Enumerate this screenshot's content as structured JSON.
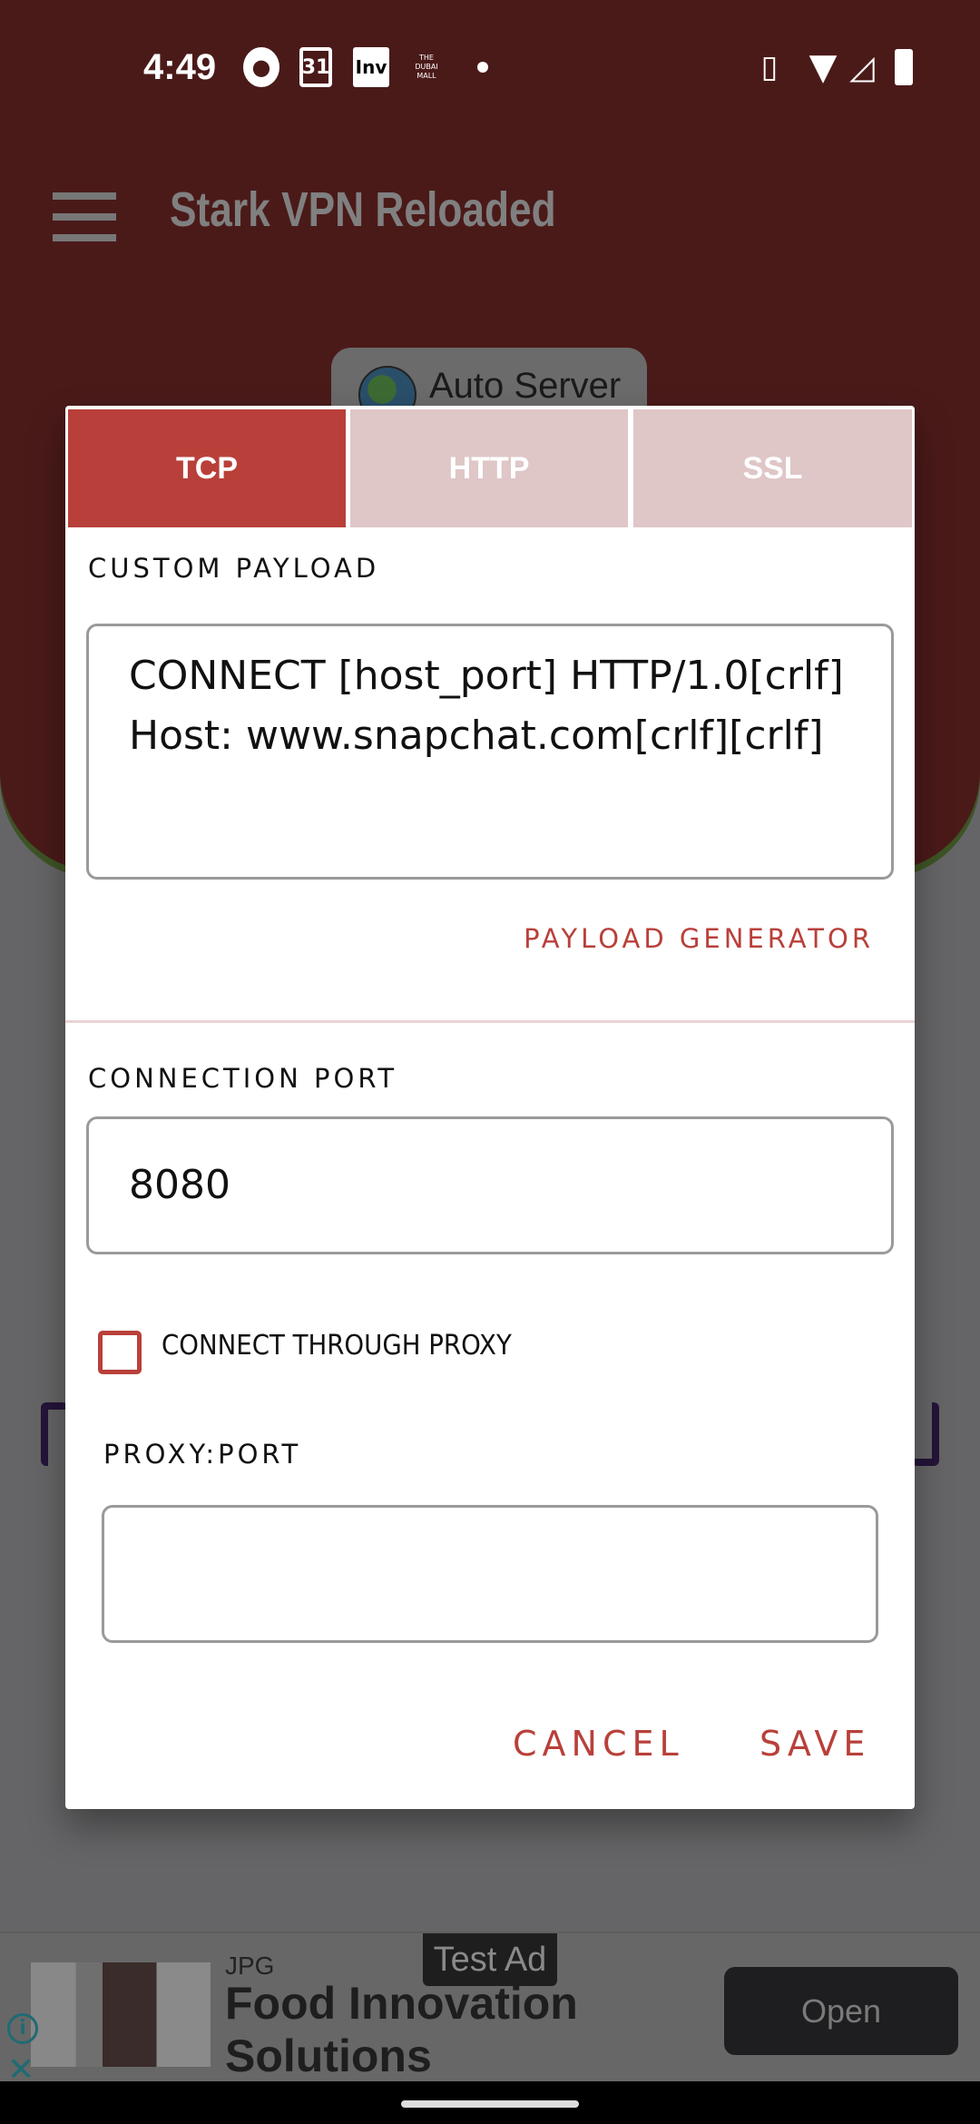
{
  "status_bar": {
    "time": "4:49",
    "notif_icons": [
      "podcast-icon",
      "calendar-icon",
      "inv-icon",
      "dubai-mall-icon",
      "dot-icon"
    ],
    "calendar_day": "31",
    "inv_text": "Inv",
    "mall_text": "THE DUBAI MALL",
    "system_icons": [
      "vibrate-icon",
      "wifi-icon",
      "signal-off-icon",
      "battery-charging-icon"
    ]
  },
  "app_bar": {
    "title": "Stark VPN Reloaded"
  },
  "server": {
    "label": "Auto Server"
  },
  "dialog": {
    "tabs": [
      {
        "label": "TCP",
        "active": true
      },
      {
        "label": "HTTP",
        "active": false
      },
      {
        "label": "SSL",
        "active": false
      }
    ],
    "payload_label": "CUSTOM PAYLOAD",
    "payload_value": "CONNECT [host_port] HTTP/1.0[crlf]Host: www.snapchat.com[crlf][crlf]",
    "payload_generator": "PAYLOAD GENERATOR",
    "port_label": "CONNECTION PORT",
    "port_value": "8080",
    "proxy_checkbox_label": "CONNECT THROUGH PROXY",
    "proxy_checked": false,
    "proxy_label": "PROXY:PORT",
    "proxy_value": "",
    "cancel": "CANCEL",
    "save": "SAVE"
  },
  "ad": {
    "advertiser": "JPG",
    "badge": "Test Ad",
    "title": "Food Innovation Solutions",
    "cta": "Open"
  },
  "colors": {
    "accent": "#b9403a",
    "tab_inactive": "#dfc6c7",
    "header": "#4a1a19"
  }
}
